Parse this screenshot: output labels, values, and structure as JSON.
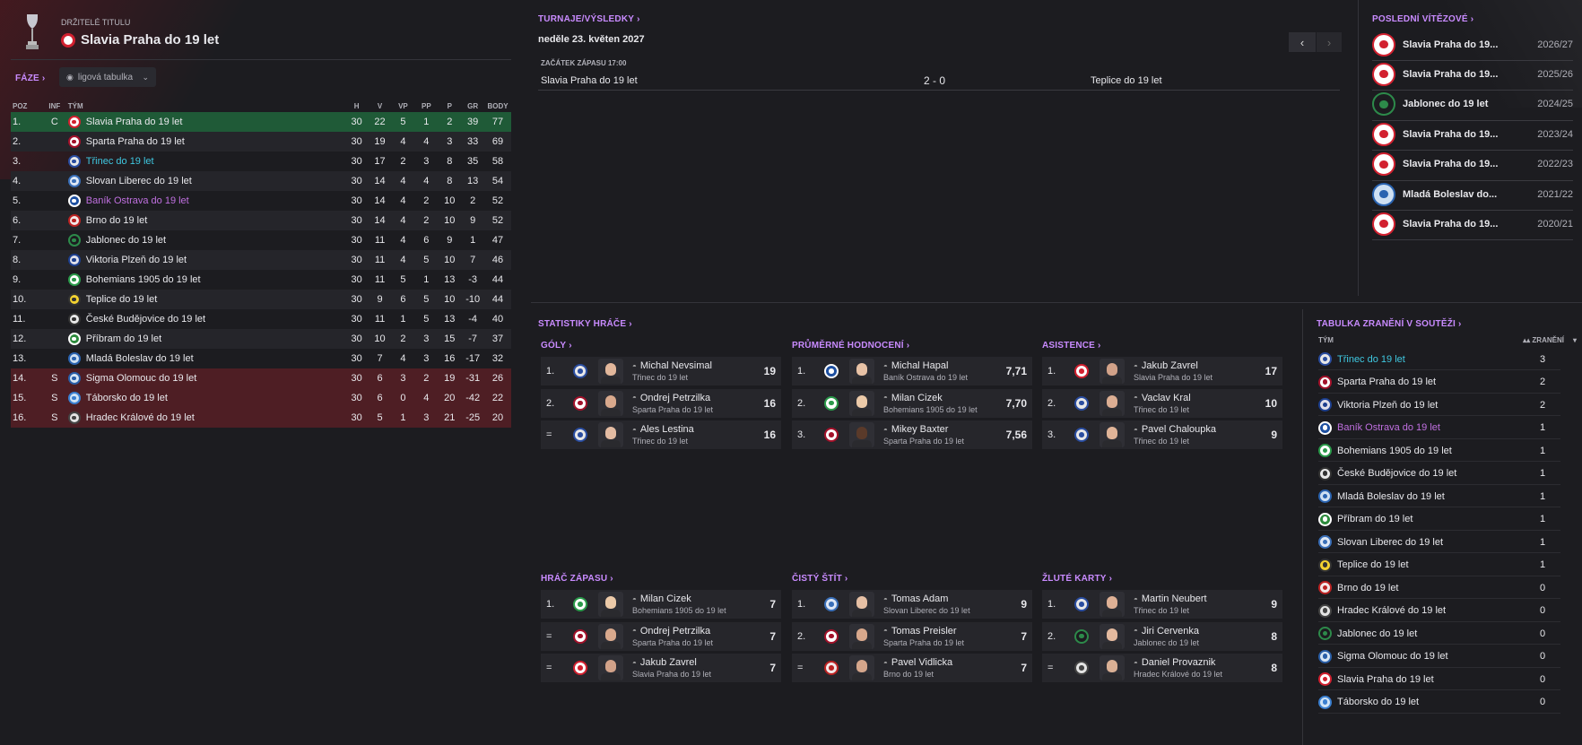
{
  "header": {
    "subtitle": "DRŽITELÉ TITULU",
    "title": "Slavia Praha do 19 let"
  },
  "phase": {
    "label": "FÁZE",
    "dropdown": "ligová tabulka"
  },
  "table": {
    "headers": {
      "poz": "POZ",
      "inf": "INF",
      "team": "TÝM",
      "h": "H",
      "v": "V",
      "vp": "VP",
      "pp": "PP",
      "p": "P",
      "gr": "GR",
      "body": "BODY"
    },
    "rows": [
      {
        "poz": "1.",
        "inf": "C",
        "team": "Slavia Praha do 19 let",
        "h": "30",
        "v": "22",
        "vp": "5",
        "pp": "1",
        "p": "2",
        "gr": "39",
        "body": "77",
        "cls": "champ",
        "tc": "",
        "crest": "slavia"
      },
      {
        "poz": "2.",
        "inf": "",
        "team": "Sparta Praha do 19 let",
        "h": "30",
        "v": "19",
        "vp": "4",
        "pp": "4",
        "p": "3",
        "gr": "33",
        "body": "69",
        "cls": "",
        "tc": "",
        "crest": "sparta"
      },
      {
        "poz": "3.",
        "inf": "",
        "team": "Třinec do 19 let",
        "h": "30",
        "v": "17",
        "vp": "2",
        "pp": "3",
        "p": "8",
        "gr": "35",
        "body": "58",
        "cls": "",
        "tc": "teal",
        "crest": "trinec"
      },
      {
        "poz": "4.",
        "inf": "",
        "team": "Slovan Liberec do 19 let",
        "h": "30",
        "v": "14",
        "vp": "4",
        "pp": "4",
        "p": "8",
        "gr": "13",
        "body": "54",
        "cls": "",
        "tc": "",
        "crest": "liberec"
      },
      {
        "poz": "5.",
        "inf": "",
        "team": "Baník Ostrava do 19 let",
        "h": "30",
        "v": "14",
        "vp": "4",
        "pp": "2",
        "p": "10",
        "gr": "2",
        "body": "52",
        "cls": "",
        "tc": "pink",
        "crest": "banik"
      },
      {
        "poz": "6.",
        "inf": "",
        "team": "Brno do 19 let",
        "h": "30",
        "v": "14",
        "vp": "4",
        "pp": "2",
        "p": "10",
        "gr": "9",
        "body": "52",
        "cls": "",
        "tc": "",
        "crest": "brno"
      },
      {
        "poz": "7.",
        "inf": "",
        "team": "Jablonec do 19 let",
        "h": "30",
        "v": "11",
        "vp": "4",
        "pp": "6",
        "p": "9",
        "gr": "1",
        "body": "47",
        "cls": "",
        "tc": "",
        "crest": "jablonec"
      },
      {
        "poz": "8.",
        "inf": "",
        "team": "Viktoria Plzeň do 19 let",
        "h": "30",
        "v": "11",
        "vp": "4",
        "pp": "5",
        "p": "10",
        "gr": "7",
        "body": "46",
        "cls": "",
        "tc": "",
        "crest": "plzen"
      },
      {
        "poz": "9.",
        "inf": "",
        "team": "Bohemians 1905 do 19 let",
        "h": "30",
        "v": "11",
        "vp": "5",
        "pp": "1",
        "p": "13",
        "gr": "-3",
        "body": "44",
        "cls": "",
        "tc": "",
        "crest": "bohemians"
      },
      {
        "poz": "10.",
        "inf": "",
        "team": "Teplice do 19 let",
        "h": "30",
        "v": "9",
        "vp": "6",
        "pp": "5",
        "p": "10",
        "gr": "-10",
        "body": "44",
        "cls": "",
        "tc": "",
        "crest": "teplice"
      },
      {
        "poz": "11.",
        "inf": "",
        "team": "České Budějovice do 19 let",
        "h": "30",
        "v": "11",
        "vp": "1",
        "pp": "5",
        "p": "13",
        "gr": "-4",
        "body": "40",
        "cls": "",
        "tc": "",
        "crest": "budejovice"
      },
      {
        "poz": "12.",
        "inf": "",
        "team": "Příbram do 19 let",
        "h": "30",
        "v": "10",
        "vp": "2",
        "pp": "3",
        "p": "15",
        "gr": "-7",
        "body": "37",
        "cls": "",
        "tc": "",
        "crest": "pribram"
      },
      {
        "poz": "13.",
        "inf": "",
        "team": "Mladá Boleslav do 19 let",
        "h": "30",
        "v": "7",
        "vp": "4",
        "pp": "3",
        "p": "16",
        "gr": "-17",
        "body": "32",
        "cls": "",
        "tc": "",
        "crest": "boleslav"
      },
      {
        "poz": "14.",
        "inf": "S",
        "team": "Sigma Olomouc do 19 let",
        "h": "30",
        "v": "6",
        "vp": "3",
        "pp": "2",
        "p": "19",
        "gr": "-31",
        "body": "26",
        "cls": "rel",
        "tc": "",
        "crest": "sigma"
      },
      {
        "poz": "15.",
        "inf": "S",
        "team": "Táborsko do 19 let",
        "h": "30",
        "v": "6",
        "vp": "0",
        "pp": "4",
        "p": "20",
        "gr": "-42",
        "body": "22",
        "cls": "rel",
        "tc": "",
        "crest": "taborsko"
      },
      {
        "poz": "16.",
        "inf": "S",
        "team": "Hradec Králové do 19 let",
        "h": "30",
        "v": "5",
        "vp": "1",
        "pp": "3",
        "p": "21",
        "gr": "-25",
        "body": "20",
        "cls": "rel",
        "tc": "",
        "crest": "hradec"
      }
    ]
  },
  "fixtures": {
    "link": "TURNAJE/VÝSLEDKY",
    "date": "neděle 23. květen 2027",
    "kickoff": "ZAČÁTEK ZÁPASU 17:00",
    "home": "Slavia Praha do 19 let",
    "score": "2 - 0",
    "away": "Teplice do 19 let",
    "prev": "‹",
    "next": "›"
  },
  "winners": {
    "link": "POSLEDNÍ VÍTĚZOVÉ",
    "rows": [
      {
        "team": "Slavia Praha do 19...",
        "season": "2026/27",
        "crest": "slavia"
      },
      {
        "team": "Slavia Praha do 19...",
        "season": "2025/26",
        "crest": "slavia"
      },
      {
        "team": "Jablonec do 19 let",
        "season": "2024/25",
        "crest": "jablonec"
      },
      {
        "team": "Slavia Praha do 19...",
        "season": "2023/24",
        "crest": "slavia"
      },
      {
        "team": "Slavia Praha do 19...",
        "season": "2022/23",
        "crest": "slavia"
      },
      {
        "team": "Mladá Boleslav do...",
        "season": "2021/22",
        "crest": "boleslav"
      },
      {
        "team": "Slavia Praha do 19...",
        "season": "2020/21",
        "crest": "slavia"
      }
    ]
  },
  "stats": {
    "link": "STATISTIKY HRÁČE",
    "sections": [
      {
        "title": "GÓLY",
        "rows": [
          {
            "rank": "1.",
            "name": "Michal Nevsimal",
            "club": "Třinec do 19 let",
            "tc": "teal",
            "val": "19",
            "crest": "trinec",
            "skin": "#e2b79b"
          },
          {
            "rank": "2.",
            "name": "Ondrej Petrzilka",
            "club": "Sparta Praha do 19 let",
            "tc": "",
            "val": "16",
            "crest": "sparta",
            "skin": "#d9a98d"
          },
          {
            "rank": "=",
            "name": "Ales Lestina",
            "club": "Třinec do 19 let",
            "tc": "teal",
            "val": "16",
            "crest": "trinec",
            "skin": "#e4bca3"
          }
        ]
      },
      {
        "title": "PRŮMĚRNÉ HODNOCENÍ",
        "rows": [
          {
            "rank": "1.",
            "name": "Michal Hapal",
            "club": "Baník Ostrava do 19 let",
            "tc": "pink",
            "val": "7,71",
            "crest": "banik",
            "skin": "#e8c2a6"
          },
          {
            "rank": "2.",
            "name": "Milan Cizek",
            "club": "Bohemians 1905 do 19 let",
            "tc": "",
            "val": "7,70",
            "crest": "bohemians",
            "skin": "#eccaa9"
          },
          {
            "rank": "3.",
            "name": "Mikey Baxter",
            "club": "Sparta Praha do 19 let",
            "tc": "",
            "val": "7,56",
            "crest": "sparta",
            "skin": "#5a3a2a"
          }
        ]
      },
      {
        "title": "ASISTENCE",
        "rows": [
          {
            "rank": "1.",
            "name": "Jakub Zavrel",
            "club": "Slavia Praha do 19 let",
            "tc": "",
            "val": "17",
            "crest": "slavia",
            "skin": "#d2a289"
          },
          {
            "rank": "2.",
            "name": "Vaclav Kral",
            "club": "Třinec do 19 let",
            "tc": "teal",
            "val": "10",
            "crest": "trinec",
            "skin": "#dcae93"
          },
          {
            "rank": "3.",
            "name": "Pavel Chaloupka",
            "club": "Třinec do 19 let",
            "tc": "teal",
            "val": "9",
            "crest": "trinec",
            "skin": "#e0b498"
          }
        ]
      },
      {
        "title": "HRÁČ ZÁPASU",
        "rows": [
          {
            "rank": "1.",
            "name": "Milan Cizek",
            "club": "Bohemians 1905 do 19 let",
            "tc": "",
            "val": "7",
            "crest": "bohemians",
            "skin": "#eccaa9"
          },
          {
            "rank": "=",
            "name": "Ondrej Petrzilka",
            "club": "Sparta Praha do 19 let",
            "tc": "",
            "val": "7",
            "crest": "sparta",
            "skin": "#d9a98d"
          },
          {
            "rank": "=",
            "name": "Jakub Zavrel",
            "club": "Slavia Praha do 19 let",
            "tc": "",
            "val": "7",
            "crest": "slavia",
            "skin": "#d2a289"
          }
        ]
      },
      {
        "title": "ČISTÝ ŠTÍT",
        "rows": [
          {
            "rank": "1.",
            "name": "Tomas Adam",
            "club": "Slovan Liberec do 19 let",
            "tc": "",
            "val": "9",
            "crest": "liberec",
            "skin": "#e6c0a5"
          },
          {
            "rank": "2.",
            "name": "Tomas Preisler",
            "club": "Sparta Praha do 19 let",
            "tc": "",
            "val": "7",
            "crest": "sparta",
            "skin": "#d8a88c"
          },
          {
            "rank": "=",
            "name": "Pavel Vidlicka",
            "club": "Brno do 19 let",
            "tc": "",
            "val": "7",
            "crest": "brno",
            "skin": "#d5a68b"
          }
        ]
      },
      {
        "title": "ŽLUTÉ KARTY",
        "rows": [
          {
            "rank": "1.",
            "name": "Martin Neubert",
            "club": "Třinec do 19 let",
            "tc": "teal",
            "val": "9",
            "crest": "trinec",
            "skin": "#dfb196"
          },
          {
            "rank": "2.",
            "name": "Jiri Cervenka",
            "club": "Jablonec do 19 let",
            "tc": "",
            "val": "8",
            "crest": "jablonec",
            "skin": "#e3b99e"
          },
          {
            "rank": "=",
            "name": "Daniel Provaznik",
            "club": "Hradec Králové do 19 let",
            "tc": "",
            "val": "8",
            "crest": "hradec",
            "skin": "#dab095"
          }
        ]
      }
    ]
  },
  "injuries": {
    "link": "TABULKA ZRANĚNÍ V SOUTĚŽI",
    "col_team": "TÝM",
    "col_val": "ZRANĚNÍ",
    "rows": [
      {
        "team": "Třinec do 19 let",
        "val": "3",
        "tc": "teal",
        "crest": "trinec"
      },
      {
        "team": "Sparta Praha do 19 let",
        "val": "2",
        "tc": "",
        "crest": "sparta"
      },
      {
        "team": "Viktoria Plzeň do 19 let",
        "val": "2",
        "tc": "",
        "crest": "plzen"
      },
      {
        "team": "Baník Ostrava do 19 let",
        "val": "1",
        "tc": "pink",
        "crest": "banik"
      },
      {
        "team": "Bohemians 1905 do 19 let",
        "val": "1",
        "tc": "",
        "crest": "bohemians"
      },
      {
        "team": "České Budějovice do 19 let",
        "val": "1",
        "tc": "",
        "crest": "budejovice"
      },
      {
        "team": "Mladá Boleslav do 19 let",
        "val": "1",
        "tc": "",
        "crest": "boleslav"
      },
      {
        "team": "Příbram do 19 let",
        "val": "1",
        "tc": "",
        "crest": "pribram"
      },
      {
        "team": "Slovan Liberec do 19 let",
        "val": "1",
        "tc": "",
        "crest": "liberec"
      },
      {
        "team": "Teplice do 19 let",
        "val": "1",
        "tc": "",
        "crest": "teplice"
      },
      {
        "team": "Brno do 19 let",
        "val": "0",
        "tc": "",
        "crest": "brno"
      },
      {
        "team": "Hradec Králové do 19 let",
        "val": "0",
        "tc": "",
        "crest": "hradec"
      },
      {
        "team": "Jablonec do 19 let",
        "val": "0",
        "tc": "",
        "crest": "jablonec"
      },
      {
        "team": "Sigma Olomouc do 19 let",
        "val": "0",
        "tc": "",
        "crest": "sigma"
      },
      {
        "team": "Slavia Praha do 19 let",
        "val": "0",
        "tc": "",
        "crest": "slavia"
      },
      {
        "team": "Táborsko do 19 let",
        "val": "0",
        "tc": "",
        "crest": "taborsko"
      }
    ]
  },
  "colors": {
    "accent": "#c98bff",
    "champion_row": "#1f5a37",
    "relegation_row": "#4e1e24",
    "teal_text": "#3fc7e0",
    "pink_text": "#c070e0"
  },
  "crests": {
    "slavia": {
      "bg": "#ffffff",
      "fg": "#d2202f",
      "icon": "slavia-crest-icon"
    },
    "sparta": {
      "bg": "#ffffff",
      "fg": "#a3112a",
      "icon": "sparta-crest-icon"
    },
    "trinec": {
      "bg": "#e8e8e8",
      "fg": "#2a4da0",
      "icon": "trinec-crest-icon"
    },
    "liberec": {
      "bg": "#dfe8f5",
      "fg": "#3a6fb8",
      "icon": "liberec-crest-icon"
    },
    "banik": {
      "bg": "#1d4fa0",
      "fg": "#ffffff",
      "icon": "banik-crest-icon"
    },
    "brno": {
      "bg": "#f2e8e8",
      "fg": "#b22",
      "icon": "brno-crest-icon"
    },
    "jablonec": {
      "bg": "#1c1c20",
      "fg": "#2d8a4a",
      "icon": "jablonec-crest-icon"
    },
    "plzen": {
      "bg": "#e0e0ea",
      "fg": "#1d3f8f",
      "icon": "plzen-crest-icon"
    },
    "bohemians": {
      "bg": "#ffffff",
      "fg": "#2a9a4a",
      "icon": "bohemians-crest-icon"
    },
    "teplice": {
      "bg": "#f3d230",
      "fg": "#333",
      "icon": "teplice-crest-icon"
    },
    "budejovice": {
      "bg": "#e8e8e8",
      "fg": "#333",
      "icon": "budejovice-crest-icon"
    },
    "pribram": {
      "bg": "#2c8a3c",
      "fg": "#ffffff",
      "icon": "pribram-crest-icon"
    },
    "boleslav": {
      "bg": "#cfe0f2",
      "fg": "#2a63b0",
      "icon": "boleslav-crest-icon"
    },
    "sigma": {
      "bg": "#d7e6f4",
      "fg": "#2a5fa8",
      "icon": "sigma-crest-icon"
    },
    "taborsko": {
      "bg": "#cfe3f5",
      "fg": "#3a7fd0",
      "icon": "taborsko-crest-icon"
    },
    "hradec": {
      "bg": "#e4e4e4",
      "fg": "#444",
      "icon": "hradec-crest-icon"
    }
  }
}
